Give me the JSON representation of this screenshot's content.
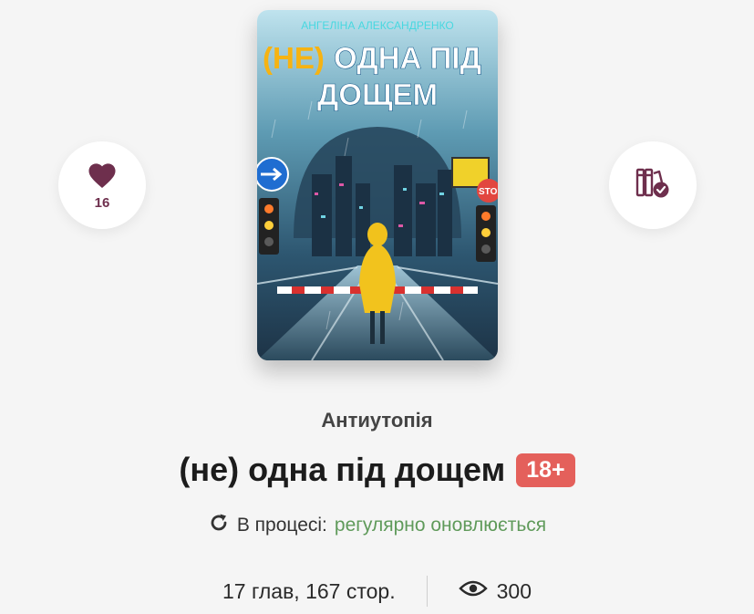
{
  "actions": {
    "likes_count": "16"
  },
  "cover": {
    "author": "АНГЕЛІНА АЛЕКСАНДРЕНКО",
    "title_highlight": "(НЕ)",
    "title_line1": "ОДНА ПІД",
    "title_line2": "ДОЩЕМ",
    "stop_sign": "STO"
  },
  "book": {
    "genre": "Антиутопія",
    "title": "(не) одна під дощем",
    "age_rating": "18+",
    "status_label": "В процесі:",
    "status_value": "регулярно оновлюється",
    "chapters_pages": "17 глав, 167 стор.",
    "views": "300"
  },
  "icons": {
    "like": "heart-icon",
    "library": "library-check-icon",
    "status": "refresh-icon",
    "views": "eye-icon"
  },
  "colors": {
    "accent": "#6e2f4d",
    "age_badge": "#e4605b",
    "status_green": "#5f9a5a"
  }
}
